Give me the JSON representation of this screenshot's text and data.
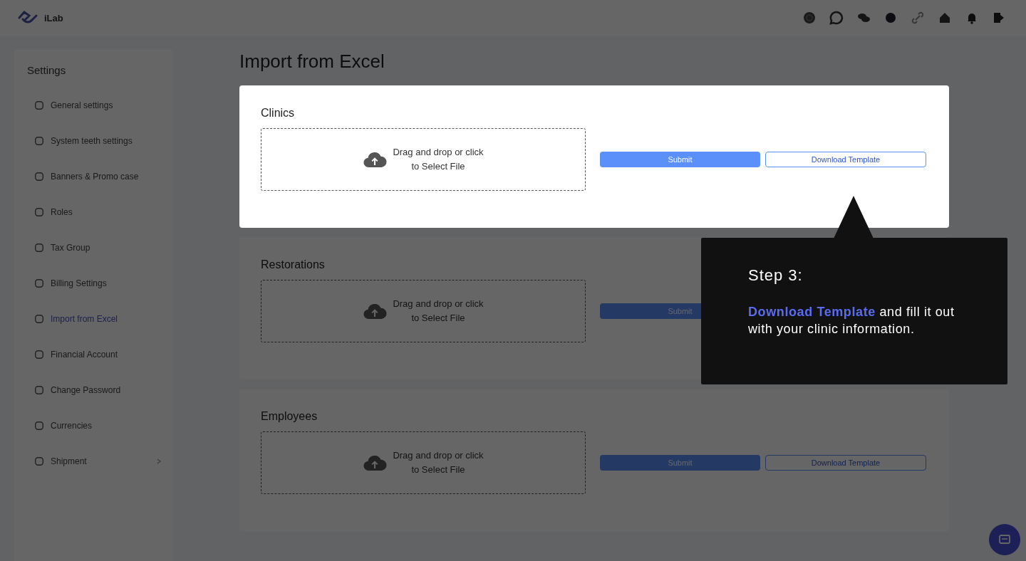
{
  "header": {
    "brand": "iLab"
  },
  "sidebar": {
    "title": "Settings",
    "items": [
      {
        "label": "General settings",
        "selected": false,
        "has_submenu": false
      },
      {
        "label": "System teeth settings",
        "selected": false,
        "has_submenu": false
      },
      {
        "label": "Banners & Promo case",
        "selected": false,
        "has_submenu": false
      },
      {
        "label": "Roles",
        "selected": false,
        "has_submenu": false
      },
      {
        "label": "Tax Group",
        "selected": false,
        "has_submenu": false
      },
      {
        "label": "Billing Settings",
        "selected": false,
        "has_submenu": false
      },
      {
        "label": "Import from Excel",
        "selected": true,
        "has_submenu": false
      },
      {
        "label": "Financial Account",
        "selected": false,
        "has_submenu": false
      },
      {
        "label": "Change Password",
        "selected": false,
        "has_submenu": false
      },
      {
        "label": "Currencies",
        "selected": false,
        "has_submenu": false
      },
      {
        "label": "Shipment",
        "selected": false,
        "has_submenu": true
      }
    ]
  },
  "page_title": "Import from Excel",
  "sections": [
    {
      "title": "Clinics",
      "dropzone_lines": [
        "Drag and drop or click",
        "to Select File"
      ],
      "submit": "Submit",
      "download": "Download Template",
      "highlighted": true
    },
    {
      "title": "Restorations",
      "dropzone_lines": [
        "Drag and drop or click",
        "to Select File"
      ],
      "submit": "Submit",
      "highlighted": false
    },
    {
      "title": "Employees",
      "dropzone_lines": [
        "Drag and drop or click",
        "to Select File"
      ],
      "submit": "Submit",
      "download": "Download Template",
      "highlighted": false
    }
  ],
  "tooltip": {
    "title": "Step 3:",
    "text": "**Download Template** and fill it out with your clinic information."
  }
}
